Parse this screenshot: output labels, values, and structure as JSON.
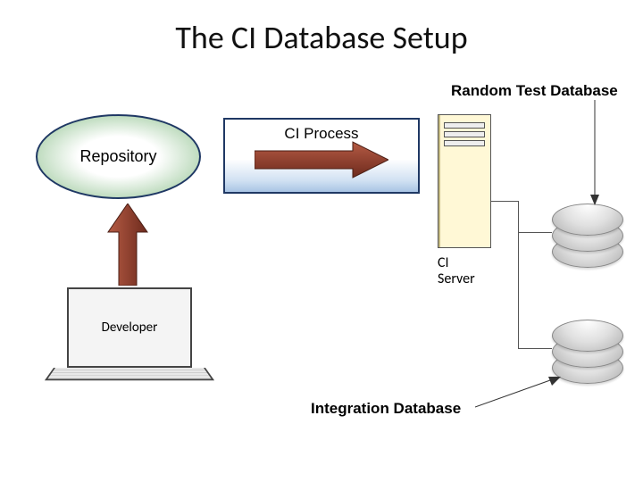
{
  "title": "The CI Database Setup",
  "nodes": {
    "repository": {
      "label": "Repository"
    },
    "ci_process": {
      "label": "CI Process"
    },
    "ci_server": {
      "label": "CI\nServer",
      "label_line1": "CI",
      "label_line2": "Server"
    },
    "developer": {
      "label": "Developer"
    },
    "random_test_db": {
      "label": "Random Test Database"
    },
    "integration_db": {
      "label": "Integration Database"
    }
  },
  "arrows": {
    "developer_to_repo": {
      "from": "developer",
      "to": "repository",
      "direction": "up",
      "color": "#8a3b2a"
    },
    "repo_to_server_via_process": {
      "from": "repository",
      "to": "ci_server",
      "direction": "right",
      "color": "#8a3b2a"
    },
    "server_to_random_db": {
      "from": "ci_server",
      "to": "random_test_db"
    },
    "server_to_integration_db": {
      "from": "ci_server",
      "to": "integration_db"
    },
    "random_label_to_db": {
      "from": "random_test_db_label",
      "to": "random_test_db_icon"
    },
    "integration_label_to_db": {
      "from": "integration_db_label",
      "to": "integration_db_icon"
    }
  },
  "colors": {
    "arrow_fill": "#8a3b2a",
    "box_border": "#1f3864"
  }
}
